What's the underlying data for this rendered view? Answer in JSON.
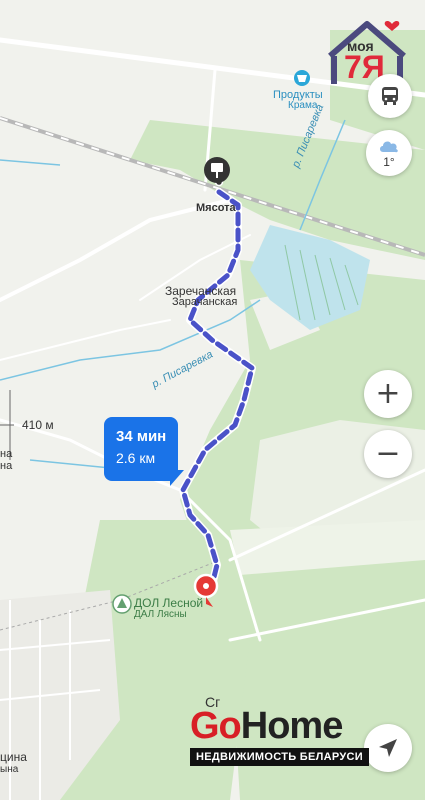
{
  "labels": {
    "myasota": "Мясота",
    "zarechanskaya_ru": "Заречанская",
    "zarechanskaya_by": "Зарачанская",
    "river_top": "р. Писаревка",
    "river_mid": "р. Писаревка",
    "shop_name": "Продукты",
    "shop_sub": "Крама",
    "camp_name": "ДОЛ Лесной",
    "camp_sub": "ДАЛ Лясны",
    "elevation": "410 м",
    "left_na1": "на",
    "left_na2": "на",
    "left_bottom1": "цина",
    "left_bottom2": "ына",
    "bottom_sign": "Сг"
  },
  "route": {
    "time": "34 мин",
    "distance": "2.6 км",
    "color": "#4a52c8"
  },
  "controls": {
    "zoom_in": "+",
    "zoom_out": "−",
    "temperature": "1°"
  },
  "watermarks": {
    "top_logo_text": "моя",
    "top_logo_num": "7Я",
    "gohome_go": "Go",
    "gohome_home": "Home",
    "gohome_sub": "НЕДВИЖИМОСТЬ БЕЛАРУСИ"
  },
  "colors": {
    "forest": "#cfe6c2",
    "field": "#f2f3ee",
    "road": "#ffffff",
    "water": "#8fd0e8",
    "accent": "#1a73e8",
    "pin": "#e53935"
  }
}
